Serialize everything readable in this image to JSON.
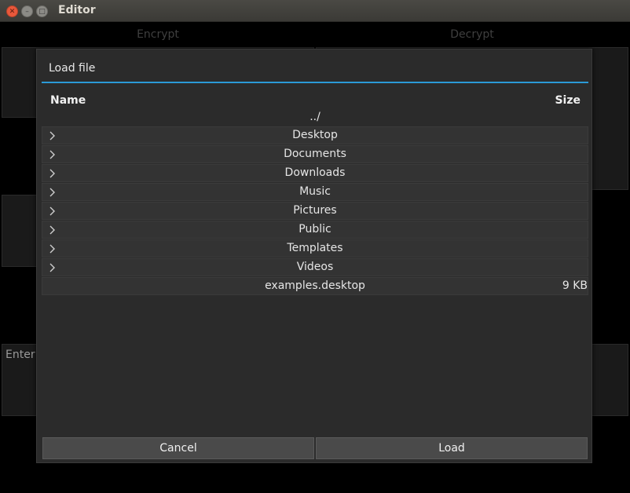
{
  "window": {
    "title": "Editor"
  },
  "app": {
    "tabs": [
      {
        "label": "Encrypt"
      },
      {
        "label": "Decrypt"
      }
    ],
    "enter_label": "Enter"
  },
  "dialog": {
    "title": "Load file",
    "columns": {
      "name": "Name",
      "size": "Size"
    },
    "parent": "../",
    "entries": [
      {
        "name": "Desktop",
        "type": "folder",
        "size": ""
      },
      {
        "name": "Documents",
        "type": "folder",
        "size": ""
      },
      {
        "name": "Downloads",
        "type": "folder",
        "size": ""
      },
      {
        "name": "Music",
        "type": "folder",
        "size": ""
      },
      {
        "name": "Pictures",
        "type": "folder",
        "size": ""
      },
      {
        "name": "Public",
        "type": "folder",
        "size": ""
      },
      {
        "name": "Templates",
        "type": "folder",
        "size": ""
      },
      {
        "name": "Videos",
        "type": "folder",
        "size": ""
      },
      {
        "name": "examples.desktop",
        "type": "file",
        "size": "9 KB"
      }
    ],
    "buttons": {
      "cancel": "Cancel",
      "load": "Load"
    }
  },
  "colors": {
    "accent": "#2b9ad6",
    "dialog_bg": "#2b2b2b",
    "button_bg": "#4a4a4a"
  },
  "icons": {
    "folder_expander": "chevron-right-icon"
  }
}
